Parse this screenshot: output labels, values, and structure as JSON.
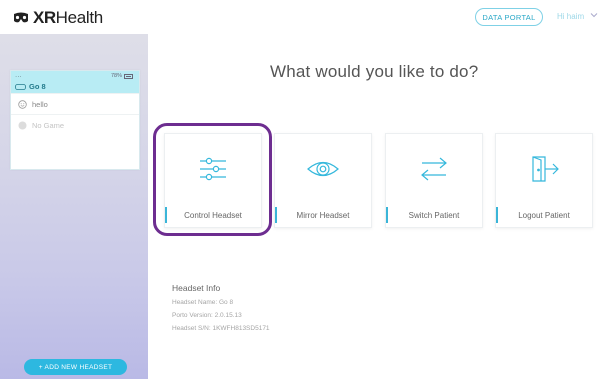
{
  "header": {
    "logo_bold": "XR",
    "logo_light": "Health",
    "portal_button": "DATA PORTAL",
    "user_name": "Hi haim"
  },
  "sidebar": {
    "device": {
      "name": "Go 8",
      "battery": "78%",
      "menu_dots": "..."
    },
    "items": [
      {
        "label": "hello"
      },
      {
        "label": "No Game"
      }
    ],
    "add_button": "+ ADD NEW HEADSET"
  },
  "main": {
    "title": "What would you like to do?",
    "tiles": [
      {
        "label": "Control Headset",
        "icon": "sliders-icon"
      },
      {
        "label": "Mirror Headset",
        "icon": "eye-icon"
      },
      {
        "label": "Switch Patient",
        "icon": "swap-arrows-icon"
      },
      {
        "label": "Logout Patient",
        "icon": "door-exit-icon"
      }
    ],
    "highlighted_tile": "Control Headset",
    "headset_info": {
      "title": "Headset Info",
      "name_line": "Headset Name: Go 8",
      "version_line": "Porto Version: 2.0.15.13",
      "sn_line": "Headset S/N: 1KWFH813SD5171"
    }
  },
  "colors": {
    "accent": "#2db8e0",
    "highlight": "#6d2d90",
    "device_header": "#b8ecf4"
  }
}
